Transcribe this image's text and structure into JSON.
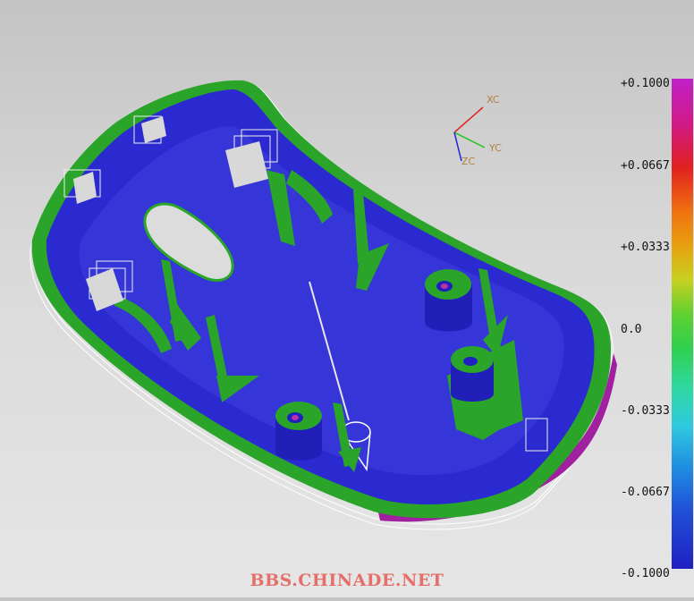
{
  "legend": {
    "labels": [
      "+0.1000",
      "+0.0667",
      "+0.0333",
      "0.0",
      "-0.0333",
      "-0.0667",
      "-0.1000"
    ]
  },
  "axes": {
    "xc": "XC",
    "yc": "YC",
    "zc": "ZC"
  },
  "watermark": "BBS.CHINADE.NET",
  "colors": {
    "mesh_blue": "#2a2ad0",
    "mesh_green": "#2aa52a",
    "mesh_magenta": "#a020a0",
    "axis_x": "#e02020",
    "axis_y": "#20c020",
    "axis_z": "#2020e0"
  }
}
